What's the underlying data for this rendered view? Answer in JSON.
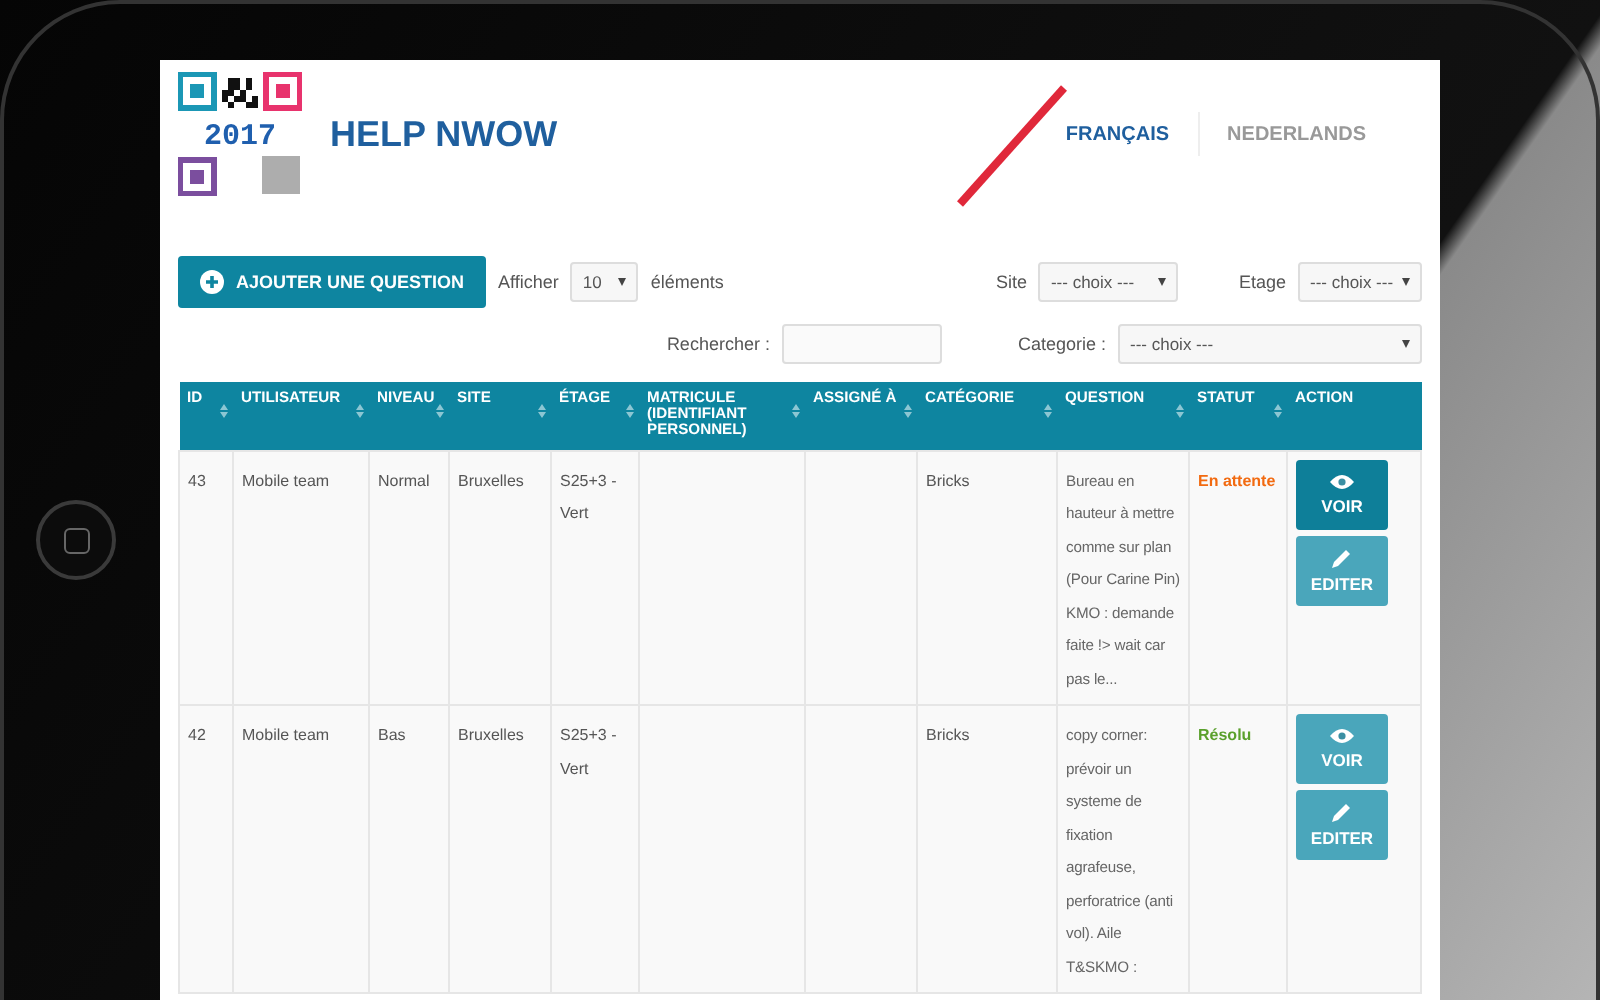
{
  "header": {
    "logo_text": "2017",
    "title": "HELP NWOW",
    "languages": [
      {
        "label": "FRANÇAIS",
        "selected": true
      },
      {
        "label": "NEDERLANDS",
        "selected": false
      }
    ]
  },
  "toolbar": {
    "add_button": "AJOUTER UNE QUESTION",
    "show_label": "Afficher",
    "show_value": "10",
    "show_suffix": "éléments",
    "site_label": "Site",
    "site_value": "--- choix ---",
    "floor_label": "Etage",
    "floor_value": "--- choix ---",
    "search_label": "Rechercher :",
    "category_label": "Categorie :",
    "category_value": "--- choix ---"
  },
  "table": {
    "columns": [
      {
        "label": "ID",
        "sortable": true
      },
      {
        "label": "UTILISATEUR",
        "sortable": true
      },
      {
        "label": "NIVEAU",
        "sortable": true
      },
      {
        "label": "SITE",
        "sortable": true
      },
      {
        "label": "ÉTAGE",
        "sortable": true
      },
      {
        "label": "MATRICULE (IDENTIFIANT PERSONNEL)",
        "sortable": true
      },
      {
        "label": "ASSIGNÉ À",
        "sortable": true
      },
      {
        "label": "CATÉGORIE",
        "sortable": true
      },
      {
        "label": "QUESTION",
        "sortable": true
      },
      {
        "label": "STATUT",
        "sortable": true
      },
      {
        "label": "ACTION",
        "sortable": false
      }
    ],
    "rows": [
      {
        "cells": [
          "43",
          "Mobile team",
          "Normal",
          "Bruxelles",
          "S25+3 - Vert",
          "",
          "",
          "Bricks",
          "Bureau en hauteur à mettre comme sur plan (Pour Carine Pin) KMO : demande faite !> wait car pas le..."
        ],
        "status": {
          "text": "En attente",
          "color": "#f26a10"
        },
        "actions": [
          {
            "label": "VOIR",
            "kind": "view",
            "active": true
          },
          {
            "label": "EDITER",
            "kind": "edit",
            "active": false
          }
        ]
      },
      {
        "cells": [
          "42",
          "Mobile team",
          "Bas",
          "Bruxelles",
          "S25+3 - Vert",
          "",
          "",
          "Bricks",
          "copy corner: prévoir un systeme de fixation agrafeuse, perforatrice (anti vol). Aile T&SKMO :"
        ],
        "status": {
          "text": "Résolu",
          "color": "#5aa02c"
        },
        "actions": [
          {
            "label": "VOIR",
            "kind": "view",
            "active": false
          },
          {
            "label": "EDITER",
            "kind": "edit",
            "active": false
          }
        ]
      }
    ]
  }
}
